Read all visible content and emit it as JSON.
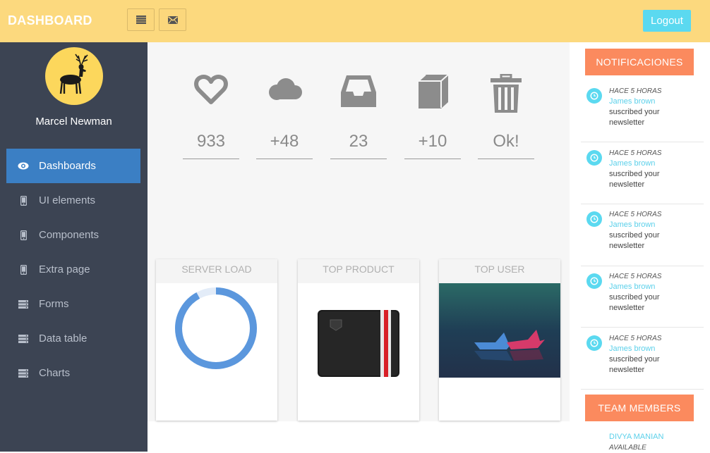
{
  "header": {
    "brand": "DASHBOARD",
    "buttons": [
      {
        "icon": "list-icon"
      },
      {
        "icon": "envelope-icon"
      }
    ],
    "logout_label": "Logout",
    "background": "#fcd97e",
    "accent": "#5bd9f0"
  },
  "sidebar": {
    "user_name": "Marcel Newman",
    "avatar_icon": "deer-icon",
    "items": [
      {
        "label": "Dashboards",
        "icon": "eye-icon",
        "active": true
      },
      {
        "label": "UI elements",
        "icon": "mobile-icon",
        "active": false
      },
      {
        "label": "Components",
        "icon": "mobile-icon",
        "active": false
      },
      {
        "label": "Extra page",
        "icon": "mobile-icon",
        "active": false
      },
      {
        "label": "Forms",
        "icon": "server-icon",
        "active": false
      },
      {
        "label": "Data table",
        "icon": "server-icon",
        "active": false
      },
      {
        "label": "Charts",
        "icon": "server-icon",
        "active": false
      }
    ]
  },
  "stats": [
    {
      "icon": "heart-icon",
      "value": "933"
    },
    {
      "icon": "cloud-icon",
      "value": "+48"
    },
    {
      "icon": "inbox-icon",
      "value": "23"
    },
    {
      "icon": "book-icon",
      "value": "+10"
    },
    {
      "icon": "trash-icon",
      "value": "Ok!"
    }
  ],
  "cards": [
    {
      "title": "SERVER LOAD",
      "load_fraction": 0.92
    },
    {
      "title": "TOP PRODUCT",
      "image": "wallet-image"
    },
    {
      "title": "TOP USER",
      "image": "paper-boats-image"
    }
  ],
  "notifications": {
    "title": "NOTIFICACIONES",
    "items": [
      {
        "time": "HACE 5 HORAS",
        "name": "James brown",
        "line1": "suscribed your",
        "line2": "newsletter"
      },
      {
        "time": "HACE 5 HORAS",
        "name": "James brown",
        "line1": "suscribed your",
        "line2": "newsletter"
      },
      {
        "time": "HACE 5 HORAS",
        "name": "James brown",
        "line1": "suscribed your",
        "line2": "newsletter"
      },
      {
        "time": "HACE 5 HORAS",
        "name": "James brown",
        "line1": "suscribed your",
        "line2": "newsletter"
      },
      {
        "time": "HACE 5 HORAS",
        "name": "James brown",
        "line1": "suscribed your",
        "line2": "newsletter"
      }
    ]
  },
  "team": {
    "title": "TEAM MEMBERS",
    "members": [
      {
        "name": "DIVYA MANIAN",
        "status": "AVAILABLE"
      }
    ]
  }
}
